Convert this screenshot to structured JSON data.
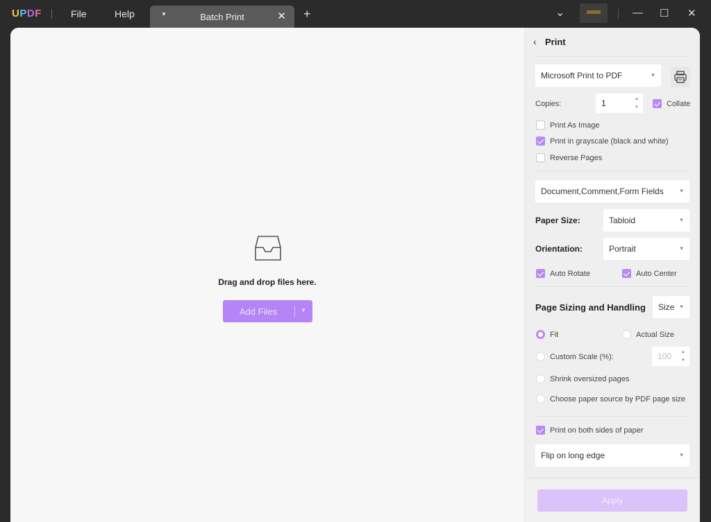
{
  "app": {
    "logo_letters": [
      "U",
      "P",
      "D",
      "F"
    ],
    "menu": {
      "file": "File",
      "help": "Help"
    },
    "tab": {
      "title": "Batch Print",
      "dropdown_glyph": "▼",
      "close_glyph": "✕"
    },
    "add_tab_glyph": "+",
    "window_controls": {
      "dropdown": "⌄",
      "minimize": "—",
      "maximize": "☐",
      "close": "✕"
    }
  },
  "dropzone": {
    "message": "Drag and drop files here.",
    "add_files_label": "Add Files",
    "add_files_dropdown_glyph": "▼"
  },
  "print_panel": {
    "back_glyph": "‹",
    "title": "Print",
    "printer": {
      "value": "Microsoft Print to PDF"
    },
    "copies": {
      "label": "Copies:",
      "value": "1"
    },
    "collate": {
      "label": "Collate",
      "checked": true
    },
    "print_as_image": {
      "label": "Print As Image",
      "checked": false
    },
    "grayscale": {
      "label": "Print in grayscale (black and white)",
      "checked": true
    },
    "reverse_pages": {
      "label": "Reverse Pages",
      "checked": false
    },
    "content": {
      "value": "Document,Comment,Form Fields"
    },
    "paper_size": {
      "label": "Paper Size:",
      "value": "Tabloid"
    },
    "orientation": {
      "label": "Orientation:",
      "value": "Portrait"
    },
    "auto_rotate": {
      "label": "Auto Rotate",
      "checked": true
    },
    "auto_center": {
      "label": "Auto Center",
      "checked": true
    },
    "page_sizing": {
      "label": "Page Sizing and Handling",
      "value": "Size"
    },
    "fit": {
      "label": "Fit",
      "selected": true
    },
    "actual_size": {
      "label": "Actual Size",
      "selected": false
    },
    "custom_scale": {
      "label": "Custom Scale (%):",
      "selected": false,
      "value": "100"
    },
    "shrink_oversized": {
      "label": "Shrink oversized pages",
      "selected": false
    },
    "paper_source": {
      "label": "Choose paper source by PDF page size",
      "selected": false
    },
    "duplex": {
      "label": "Print on both sides of paper",
      "checked": true
    },
    "flip": {
      "value": "Flip on long edge"
    },
    "apply_label": "Apply",
    "dropdown_glyph": "▼",
    "spin_up_glyph": "▲",
    "spin_down_glyph": "▼"
  },
  "colors": {
    "accent": "#b88af2",
    "accent_disabled": "#d9c3fa",
    "titlebar": "#2b2b2b",
    "panel_bg": "#efefef"
  }
}
